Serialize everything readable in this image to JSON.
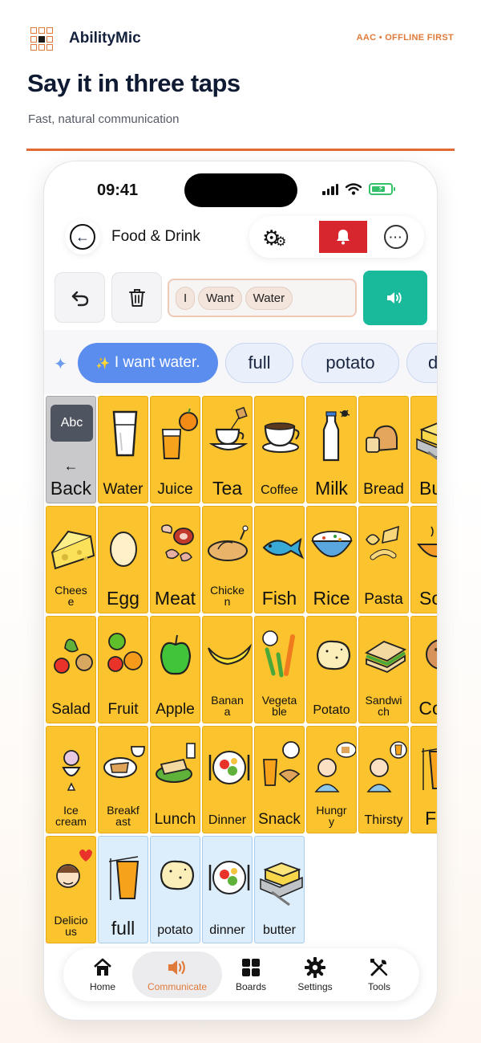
{
  "brand": {
    "name": "AbilityMic",
    "tagline": "AAC • OFFLINE FIRST",
    "accent": "#e07a3a"
  },
  "hero": {
    "headline": "Say it in three taps",
    "subline": "Fast, natural communication"
  },
  "status": {
    "time": "09:41"
  },
  "header": {
    "title": "Food & Drink",
    "alert_color": "#d8262e"
  },
  "message": {
    "words": [
      "I",
      "Want",
      "Water"
    ]
  },
  "suggestions": {
    "primary": "I want water.",
    "alts": [
      "full",
      "potato",
      "d"
    ]
  },
  "grid": {
    "abc_label": "Abc",
    "rows": [
      [
        {
          "label": "Back",
          "icon": "back-arrow",
          "style": "grey"
        },
        {
          "label": "Water",
          "icon": "glass-of-water"
        },
        {
          "label": "Juice",
          "icon": "orange-juice"
        },
        {
          "label": "Tea",
          "icon": "tea-cup"
        },
        {
          "label": "Coffee",
          "icon": "coffee-cup"
        },
        {
          "label": "Milk",
          "icon": "milk-bottle"
        },
        {
          "label": "Bread",
          "icon": "bread-loaf"
        },
        {
          "label": "Butt",
          "icon": "butter"
        }
      ],
      [
        {
          "label": "Chees\ne",
          "icon": "cheese"
        },
        {
          "label": "Egg",
          "icon": "egg"
        },
        {
          "label": "Meat",
          "icon": "meat"
        },
        {
          "label": "Chicke\nn",
          "icon": "roast-chicken"
        },
        {
          "label": "Fish",
          "icon": "fish"
        },
        {
          "label": "Rice",
          "icon": "rice-bowl"
        },
        {
          "label": "Pasta",
          "icon": "pasta"
        },
        {
          "label": "Sou",
          "icon": "soup"
        }
      ],
      [
        {
          "label": "Salad",
          "icon": "salad"
        },
        {
          "label": "Fruit",
          "icon": "fruit"
        },
        {
          "label": "Apple",
          "icon": "apple"
        },
        {
          "label": "Banan\na",
          "icon": "banana"
        },
        {
          "label": "Vegeta\nble",
          "icon": "vegetables"
        },
        {
          "label": "Potato",
          "icon": "potato"
        },
        {
          "label": "Sandwi\nch",
          "icon": "sandwich"
        },
        {
          "label": "Coo",
          "icon": "cookie"
        }
      ],
      [
        {
          "label": "Ice\ncream",
          "icon": "ice-cream"
        },
        {
          "label": "Breakf\nast",
          "icon": "breakfast"
        },
        {
          "label": "Lunch",
          "icon": "lunch"
        },
        {
          "label": "Dinner",
          "icon": "dinner-plate"
        },
        {
          "label": "Snack",
          "icon": "snack"
        },
        {
          "label": "Hungr\ny",
          "icon": "hungry-person"
        },
        {
          "label": "Thirsty",
          "icon": "thirsty-person"
        },
        {
          "label": "Fu",
          "icon": "full-glass"
        }
      ],
      [
        {
          "label": "Delicio\nus",
          "icon": "delicious-face"
        },
        {
          "label": "full",
          "icon": "full-glass",
          "style": "blue"
        },
        {
          "label": "potato",
          "icon": "potato",
          "style": "blue"
        },
        {
          "label": "dinner",
          "icon": "dinner-plate",
          "style": "blue"
        },
        {
          "label": "butter",
          "icon": "butter",
          "style": "blue"
        }
      ]
    ]
  },
  "tabs": [
    {
      "label": "Home",
      "icon": "home-icon"
    },
    {
      "label": "Communicate",
      "icon": "speaker-icon",
      "active": true
    },
    {
      "label": "Boards",
      "icon": "boards-icon"
    },
    {
      "label": "Settings",
      "icon": "settings-icon"
    },
    {
      "label": "Tools",
      "icon": "tools-icon"
    }
  ]
}
